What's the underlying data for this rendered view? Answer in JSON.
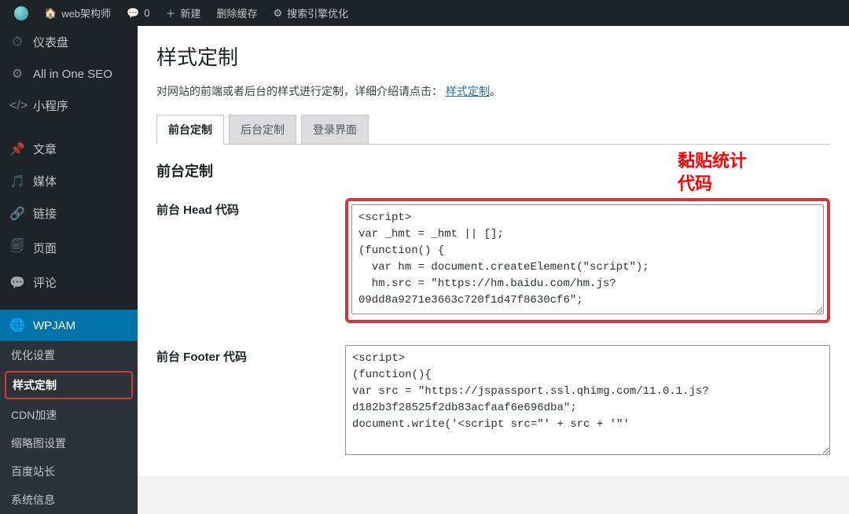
{
  "topbar": {
    "site_name": "web架构师",
    "comment_count": "0",
    "new_label": "新建",
    "cache_label": "删除缓存",
    "seo_label": "搜索引擎优化"
  },
  "sidebar": {
    "items": [
      {
        "icon": "dashboard",
        "label": "仪表盘"
      },
      {
        "icon": "aioseo",
        "label": "All in One SEO"
      },
      {
        "icon": "miniprogram",
        "label": "小程序"
      },
      {
        "icon": "posts",
        "label": "文章"
      },
      {
        "icon": "media",
        "label": "媒体"
      },
      {
        "icon": "links",
        "label": "链接"
      },
      {
        "icon": "pages",
        "label": "页面"
      },
      {
        "icon": "comments",
        "label": "评论"
      },
      {
        "icon": "wpjam",
        "label": "WPJAM"
      }
    ],
    "submenu": [
      {
        "label": "优化设置"
      },
      {
        "label": "样式定制",
        "current": true
      },
      {
        "label": "CDN加速"
      },
      {
        "label": "缩略图设置"
      },
      {
        "label": "百度站长"
      },
      {
        "label": "系统信息"
      }
    ]
  },
  "page": {
    "title": "样式定制",
    "desc_prefix": "对网站的前端或者后台的样式进行定制，详细介绍请点击：",
    "desc_link": "样式定制",
    "desc_suffix": "。"
  },
  "tabs": [
    {
      "label": "前台定制",
      "active": true
    },
    {
      "label": "后台定制"
    },
    {
      "label": "登录界面"
    }
  ],
  "section_heading": "前台定制",
  "fields": {
    "head": {
      "label": "前台 Head 代码",
      "value": "<script>\nvar _hmt = _hmt || [];\n(function() {\n  var hm = document.createElement(\"script\");\n  hm.src = \"https://hm.baidu.com/hm.js?09dd8a9271e3663c720f1d47f8630cf6\";"
    },
    "footer": {
      "label": "前台 Footer 代码",
      "value": "<script>\n(function(){\nvar src = \"https://jspassport.ssl.qhimg.com/11.0.1.js?d182b3f28525f2db83acfaaf6e696dba\";\ndocument.write('<script src=\"' + src + '\"'"
    }
  },
  "annotation": "黏贴统计\n代码"
}
